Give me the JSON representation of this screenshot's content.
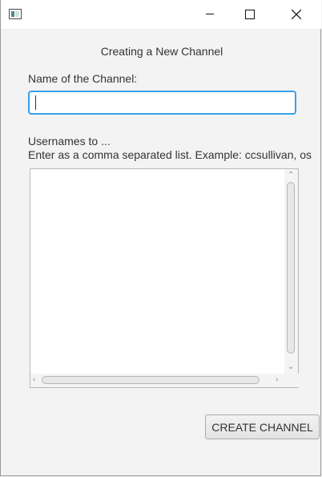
{
  "window": {
    "controls": {
      "minimize": "minimize-icon",
      "maximize": "maximize-icon",
      "close": "close-icon"
    }
  },
  "form": {
    "heading": "Creating a New Channel",
    "name_label": "Name of the Channel:",
    "name_value": "",
    "users_label": "Usernames to ...",
    "users_hint": "Enter as a comma separated list. Example: ccsullivan, os",
    "users_value": "",
    "create_button": "CREATE CHANNEL"
  },
  "colors": {
    "focus_border": "#39a0e8",
    "background": "#f3f3f3"
  }
}
